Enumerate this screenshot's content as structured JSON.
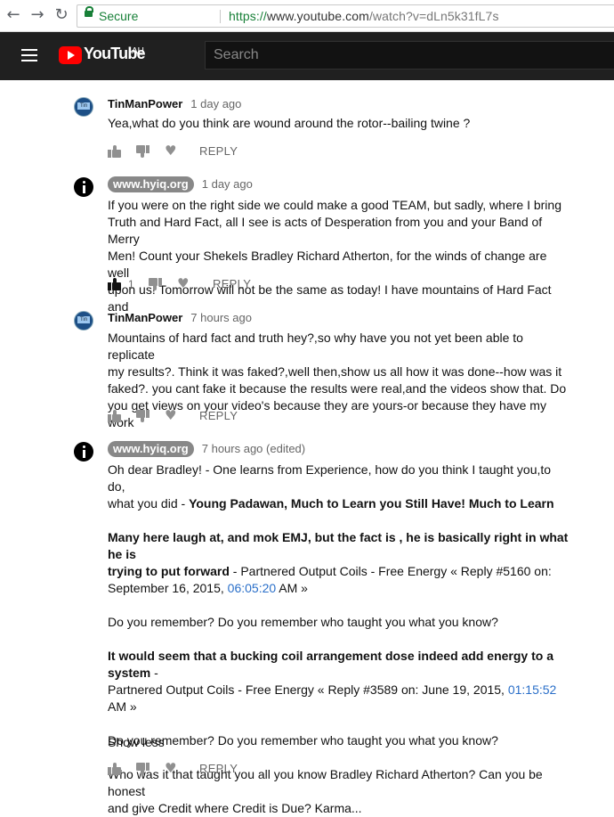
{
  "browser": {
    "secure_label": "Secure",
    "url_proto": "https://",
    "url_domain": "www.youtube.com",
    "url_path": "/watch?v=dLn5k31fL7s"
  },
  "yt": {
    "logo_text": "YouTube",
    "country": "AU",
    "search_placeholder": "Search"
  },
  "reply_label": "REPLY",
  "show_less_label": "Show less",
  "comments": [
    {
      "author": "TinManPower",
      "time": "1 day ago",
      "lines": [
        "Yea,what do you think are wound around the rotor--bailing twine ?"
      ]
    },
    {
      "author": "www.hyiq.org",
      "time": "1 day ago",
      "likes": "1",
      "lines": [
        "If you were on the right side we could make a good TEAM, but sadly, where I bring",
        "Truth and Hard Fact, all I see is acts of Desperation from you and your Band of Merry",
        "Men! Count your Shekels Bradley Richard Atherton, for the winds of change are well",
        "upon us! Tomorrow will not be the same as today! I have mountains of Hard Fact and"
      ]
    },
    {
      "author": "TinManPower",
      "time": "7 hours ago",
      "lines": [
        "Mountains of hard fact and truth hey?,so why have you not yet been able to replicate",
        "my results?. Think it was faked?,well then,show us all how it was done--how was it",
        "faked?. you cant fake it because the results were real,and the videos show that. Do",
        "you get views on your video's because they are yours-or because they have my work"
      ]
    },
    {
      "author": "www.hyiq.org",
      "time": "7 hours ago (edited)",
      "p1_line1": "Oh dear Bradley! - One learns from Experience, how do you think I taught you,to do,",
      "p1_line2_plain": "what you did - ",
      "p1_line2_bold": "Young Padawan, Much to Learn you Still Have! Much to Learn",
      "p2_bold1": "Many here laugh at, and mok EMJ, but the fact is , he is basically right in what he is",
      "p2_bold2": "trying to put forward",
      "p2_rest": " - Partnered Output Coils - Free Energy « Reply #5160 on:",
      "p2_line3_plain": "September 16, 2015, ",
      "p2_link": "06:05:20",
      "p2_line3_end": " AM »",
      "p3": "Do you remember? Do you remember who taught you what you know?",
      "p4_bold": "It would seem that a bucking coil arrangement dose indeed add energy to a system",
      "p4_dash": " -",
      "p4_line2_plain": "Partnered Output Coils - Free Energy « Reply #3589 on: June 19, 2015, ",
      "p4_link": "01:15:52",
      "p4_line2_end": " AM »",
      "p5": "Do you remember? Do you remember who taught you what you know?",
      "p6_line1": "Who was it that taught you all you know Bradley Richard Atherton? Can you be honest",
      "p6_line2": "and give Credit where Credit is Due? Karma..."
    }
  ]
}
